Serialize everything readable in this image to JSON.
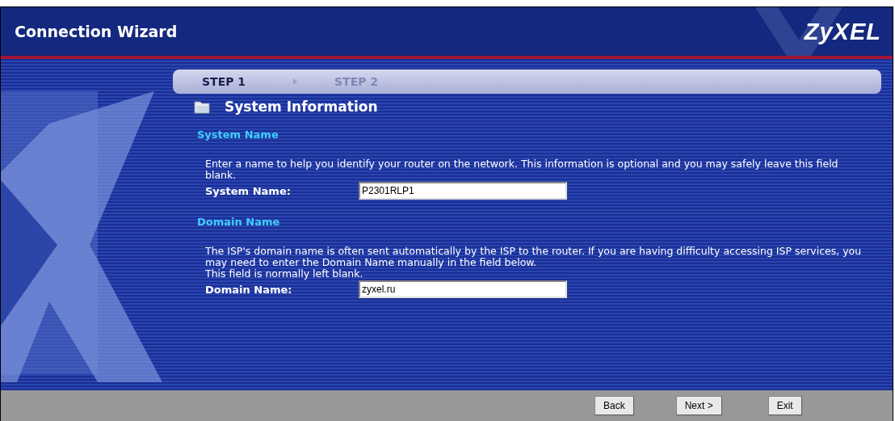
{
  "window": {
    "title": "Connection Wizard",
    "logo": "ZyXEL"
  },
  "steps": [
    {
      "label": "STEP 1",
      "selected": true
    },
    {
      "label": "STEP 2",
      "selected": false
    }
  ],
  "page_title": "System Information",
  "sections": [
    {
      "heading": "System Name",
      "description": "Enter a name to help you identify your router on the network. This information is optional and you may safely leave this field blank.",
      "field_label": "System Name:",
      "value": "P2301RLP1"
    },
    {
      "heading": "Domain Name",
      "description": "The ISP's domain name is often sent automatically by the ISP to the router. If you are having difficulty accessing ISP services, you may need to enter the Domain Name manually in the field below.\nThis field is normally left blank.",
      "field_label": "Domain Name:",
      "value": "zyxel.ru"
    }
  ],
  "buttons": [
    "Back",
    "Next >",
    "Exit"
  ]
}
